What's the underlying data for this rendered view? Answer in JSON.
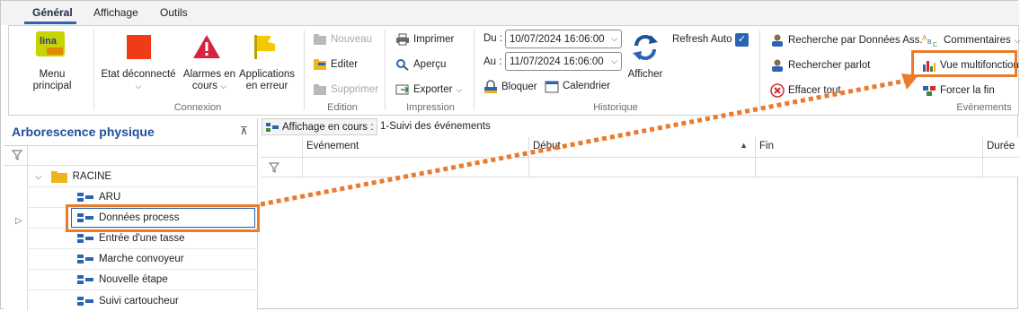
{
  "tabs": [
    {
      "label": "Général",
      "active": true
    },
    {
      "label": "Affichage",
      "active": false
    },
    {
      "label": "Outils",
      "active": false
    }
  ],
  "ribbon": {
    "menu_principal": {
      "label": "Menu principal",
      "logo_text": "lina"
    },
    "connexion": {
      "group_label": "Connexion",
      "etat": "Etat déconnecté",
      "alarmes": "Alarmes en cours",
      "applications": "Applications en erreur"
    },
    "edition": {
      "group_label": "Edition",
      "nouveau": "Nouveau",
      "editer": "Editer",
      "supprimer": "Supprimer"
    },
    "impression": {
      "group_label": "Impression",
      "imprimer": "Imprimer",
      "apercu": "Aperçu",
      "exporter": "Exporter"
    },
    "historique": {
      "group_label": "Historique",
      "du_label": "Du :",
      "du_value": "10/07/2024 16:06:00",
      "au_label": "Au :",
      "au_value": "11/07/2024 16:06:00",
      "bloquer": "Bloquer",
      "calendrier": "Calendrier",
      "afficher": "Afficher",
      "refresh_auto": "Refresh Auto",
      "refresh_checked": true
    },
    "evenements": {
      "group_label": "Evènements",
      "recherche_donnees": "Recherche par Données Ass.",
      "rechercher_parlot": "Rechercher parlot",
      "effacer_tout": "Effacer tout",
      "commentaires": "Commentaires",
      "vue_multifonction": "Vue multifonction",
      "forcer_fin": "Forcer la fin"
    }
  },
  "left_panel": {
    "title": "Arborescence physique",
    "root": "RACINE",
    "items": [
      {
        "label": "ARU"
      },
      {
        "label": "Données process"
      },
      {
        "label": "Entrée d'une tasse"
      },
      {
        "label": "Marche convoyeur"
      },
      {
        "label": "Nouvelle étape"
      },
      {
        "label": "Suivi cartoucheur"
      }
    ]
  },
  "main": {
    "affichage_label": "Affichage en cours :",
    "affichage_value": "1-Suivi des événements",
    "columns": [
      "Evénement",
      "Début",
      "Fin",
      "Durée"
    ]
  },
  "colors": {
    "accent": "#2b64b0",
    "callout": "#ea7a2d",
    "panel_title": "#1f4f9a"
  }
}
